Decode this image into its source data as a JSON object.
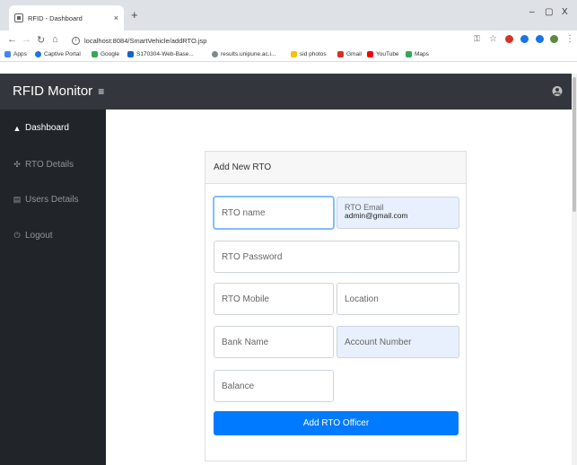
{
  "browser": {
    "tab_title": "RFID - Dashboard",
    "tab_close": "×",
    "new_tab": "+",
    "window_controls": {
      "minimize": "–",
      "restore": "▢",
      "close": "X"
    },
    "url": "localhost:8084/SmartVehicle/addRTO.jsp",
    "bookmarks": [
      {
        "label": "Apps",
        "color": "#4285f4"
      },
      {
        "label": "Captive Portal",
        "color": "#1a73e8"
      },
      {
        "label": "Google",
        "color": "#34a853"
      },
      {
        "label": "S170304-Web-Base...",
        "color": "#1565c0"
      },
      {
        "label": "results.unipune.ac.i...",
        "color": "#7b8a8b"
      },
      {
        "label": "sid photos",
        "color": "#f4c20d"
      },
      {
        "label": "Gmail",
        "color": "#d93025"
      },
      {
        "label": "YouTube",
        "color": "#ff0000"
      },
      {
        "label": "Maps",
        "color": "#34a853"
      }
    ]
  },
  "app": {
    "brand": "RFID Monitor",
    "menu_icon": "≡",
    "sidebar": [
      {
        "label": "Dashboard",
        "icon": "▲"
      },
      {
        "label": "RTO Details",
        "icon": "✣"
      },
      {
        "label": "Users Details",
        "icon": "▤"
      },
      {
        "label": "Logout",
        "icon": "⏻"
      }
    ]
  },
  "form": {
    "title": "Add New RTO",
    "rto_name_placeholder": "RTO name",
    "rto_email_label": "RTO Email",
    "rto_email_value": "admin@gmail.com",
    "rto_password_placeholder": "RTO Password",
    "rto_mobile_placeholder": "RTO Mobile",
    "location_placeholder": "Location",
    "bank_name_placeholder": "Bank Name",
    "account_number_placeholder": "Account Number",
    "balance_placeholder": "Balance",
    "submit_label": "Add RTO Officer"
  },
  "colors": {
    "header_bg": "#33373d",
    "sidebar_bg": "#212529",
    "primary": "#007bff",
    "autofill": "#e8f0fe"
  }
}
